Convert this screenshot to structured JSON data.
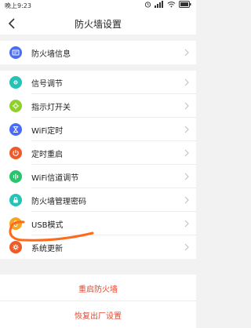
{
  "status_bar": {
    "time": "晚上9:23"
  },
  "header": {
    "title": "防火墙设置"
  },
  "group1": [
    {
      "label": "防火墙信息",
      "icon": "firewall-info-icon",
      "color": "#4a6cf7"
    }
  ],
  "group2": [
    {
      "label": "信号调节",
      "icon": "signal-icon",
      "color": "#24c3b5"
    },
    {
      "label": "指示灯开关",
      "icon": "indicator-light-icon",
      "color": "#8fcf2a"
    },
    {
      "label": "WiFi定时",
      "icon": "wifi-timer-icon",
      "color": "#4a6cf7"
    },
    {
      "label": "定时重启",
      "icon": "timed-restart-icon",
      "color": "#f05a28"
    },
    {
      "label": "WiFi信道调节",
      "icon": "wifi-channel-icon",
      "color": "#27c46b"
    },
    {
      "label": "防火墙管理密码",
      "icon": "lock-icon",
      "color": "#24c3b5"
    },
    {
      "label": "USB模式",
      "icon": "usb-icon",
      "color": "#f5a623"
    },
    {
      "label": "系统更新",
      "icon": "system-update-icon",
      "color": "#f05a28"
    }
  ],
  "actions": [
    {
      "label": "重启防火墙"
    },
    {
      "label": "恢复出厂设置"
    }
  ],
  "colors": {
    "accent": "#e8452c",
    "scribble": "#ff6a1a"
  }
}
